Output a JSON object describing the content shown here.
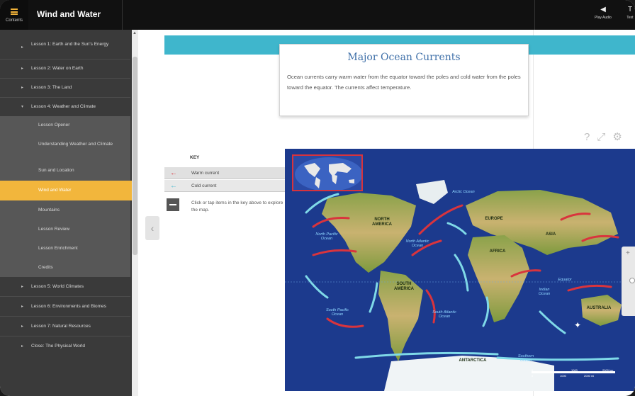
{
  "header": {
    "contents_label": "Contents",
    "app_title": "Wind and Water",
    "tools": [
      {
        "label": "Play Audio",
        "icon": "speaker-icon"
      },
      {
        "label": "Text",
        "icon": "text-icon"
      }
    ]
  },
  "sidebar": {
    "items": [
      {
        "label": "Lesson 1: Earth and the Sun's Energy",
        "type": "lesson"
      },
      {
        "label": "Lesson 2: Water on Earth",
        "type": "lesson"
      },
      {
        "label": "Lesson 3: The Land",
        "type": "lesson"
      },
      {
        "label": "Lesson 4: Weather and Climate",
        "type": "lesson-open"
      },
      {
        "label": "Lesson Opener",
        "type": "sub"
      },
      {
        "label": "Understanding Weather and Climate",
        "type": "sub"
      },
      {
        "label": "Sun and Location",
        "type": "sub"
      },
      {
        "label": "Wind and Water",
        "type": "sub-active"
      },
      {
        "label": "Mountains",
        "type": "sub"
      },
      {
        "label": "Lesson Review",
        "type": "sub"
      },
      {
        "label": "Lesson Enrichment",
        "type": "sub"
      },
      {
        "label": "Credits",
        "type": "sub"
      },
      {
        "label": "Lesson 5: World Climates",
        "type": "lesson"
      },
      {
        "label": "Lesson 6: Environments and Biomes",
        "type": "lesson"
      },
      {
        "label": "Lesson 7: Natural Resources",
        "type": "lesson"
      },
      {
        "label": "Close: The Physical World",
        "type": "lesson"
      }
    ]
  },
  "info_box": {
    "title": "Major Ocean Currents",
    "body": "Ocean currents carry warm water from the equator toward the poles and cold water from the poles toward the equator. The currents affect temperature."
  },
  "key": {
    "heading": "KEY",
    "warm_label": "Warm current",
    "cold_label": "Cold current",
    "hint": "Click or tap items in the key above to explore the map.",
    "warm_color": "#d9343d",
    "cold_color": "#3fb6cc"
  },
  "map": {
    "continents": [
      {
        "label": "NORTH AMERICA"
      },
      {
        "label": "EUROPE"
      },
      {
        "label": "ASIA"
      },
      {
        "label": "AFRICA"
      },
      {
        "label": "SOUTH AMERICA"
      },
      {
        "label": "AUSTRALIA"
      },
      {
        "label": "ANTARCTICA"
      }
    ],
    "oceans": [
      {
        "label": "Arctic Ocean"
      },
      {
        "label": "North Pacific Ocean"
      },
      {
        "label": "North Atlantic Ocean"
      },
      {
        "label": "South Pacific Ocean"
      },
      {
        "label": "South Atlantic Ocean"
      },
      {
        "label": "Indian Ocean"
      },
      {
        "label": "Equator"
      },
      {
        "label": "Southern Ocean"
      }
    ],
    "scale": {
      "km_0": "0",
      "km_1": "1000",
      "km_2": "2000 km",
      "mi_0": "0",
      "mi_1": "1000",
      "mi_2": "2000 mi"
    }
  },
  "colors": {
    "accent": "#f2b63c",
    "teal": "#3fb6cc",
    "title_blue": "#3e6fa8"
  }
}
